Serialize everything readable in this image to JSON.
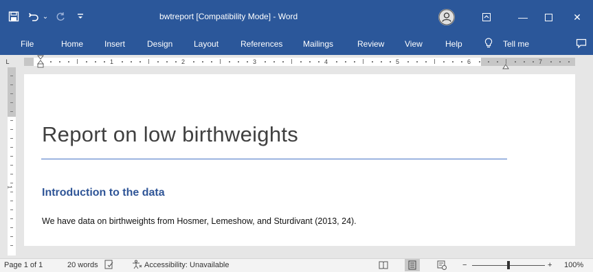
{
  "window": {
    "title": "bwtreport [Compatibility Mode]  -  Word",
    "colors": {
      "ribbon": "#2b579a",
      "heading": "#2f5597",
      "rule": "#4472c4"
    }
  },
  "quick_access": [
    {
      "name": "save-icon",
      "glyph": "🖫"
    },
    {
      "name": "undo-icon",
      "glyph": "↶"
    },
    {
      "name": "undo-dropdown-icon",
      "glyph": "⌄"
    },
    {
      "name": "redo-icon",
      "glyph": "↻"
    },
    {
      "name": "customize-qat-icon",
      "glyph": "⇣"
    }
  ],
  "window_controls": {
    "ribbon_display": "⊡",
    "minimize": "—",
    "maximize": "☐",
    "close": "✕"
  },
  "ribbon_tabs": [
    "File",
    "Home",
    "Insert",
    "Design",
    "Layout",
    "References",
    "Mailings",
    "Review",
    "View",
    "Help"
  ],
  "tell_me": {
    "icon": "lightbulb-icon",
    "label": "Tell me"
  },
  "ruler": {
    "numbers": [
      "1",
      "2",
      "3",
      "4",
      "5",
      "6",
      "7"
    ],
    "tab_selector": "L"
  },
  "document": {
    "title": "Report on low birthweights",
    "heading": "Introduction to the data",
    "body": "We have data on birthweights from Hosmer, Lemeshow, and Sturdivant (2013, 24)."
  },
  "status": {
    "page": "Page 1 of 1",
    "words": "20 words",
    "accessibility": "Accessibility: Unavailable",
    "zoom_minus": "−",
    "zoom_plus": "+",
    "zoom": "100%",
    "zoom_level": 1.0
  }
}
